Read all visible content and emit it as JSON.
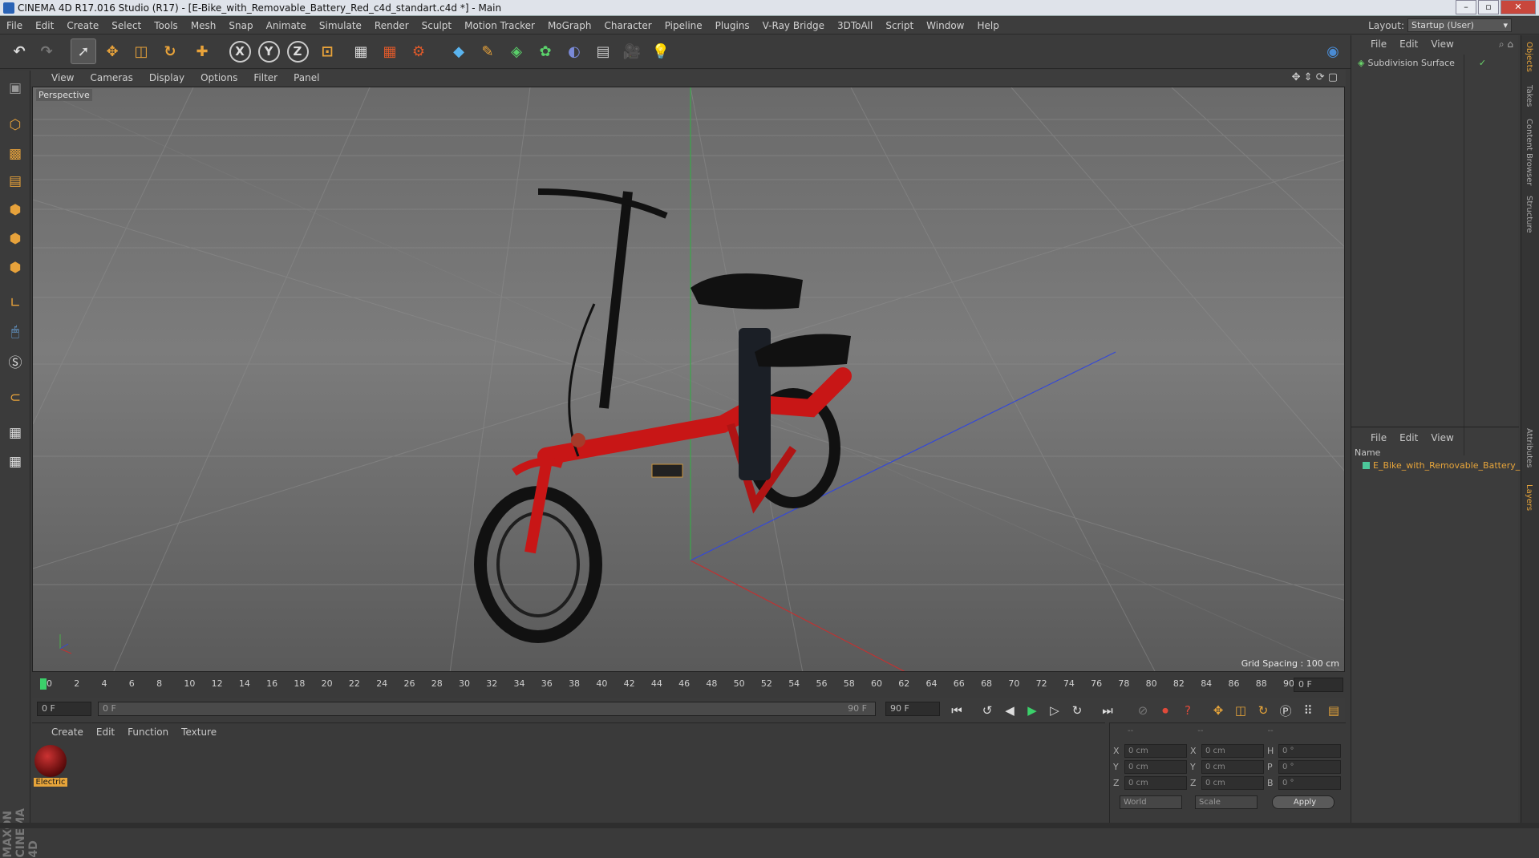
{
  "titlebar": {
    "title": "CINEMA 4D R17.016 Studio (R17) - [E-Bike_with_Removable_Battery_Red_c4d_standart.c4d *] - Main",
    "min": "–",
    "max": "▫",
    "close": "✕"
  },
  "menubar": {
    "items": [
      "File",
      "Edit",
      "Create",
      "Select",
      "Tools",
      "Mesh",
      "Snap",
      "Animate",
      "Simulate",
      "Render",
      "Sculpt",
      "Motion Tracker",
      "MoGraph",
      "Character",
      "Pipeline",
      "Plugins",
      "V-Ray Bridge",
      "3DToAll",
      "Script",
      "Window",
      "Help"
    ],
    "layout_label": "Layout:",
    "layout_value": "Startup (User)"
  },
  "toolbar": {
    "axis_x": "X",
    "axis_y": "Y",
    "axis_z": "Z"
  },
  "viewport": {
    "menu": [
      "View",
      "Cameras",
      "Display",
      "Options",
      "Filter",
      "Panel"
    ],
    "label": "Perspective",
    "grid_spacing": "Grid Spacing : 100 cm"
  },
  "objects_panel": {
    "menu": [
      "File",
      "Edit",
      "View"
    ],
    "item": "Subdivision Surface"
  },
  "layers_panel": {
    "menu": [
      "File",
      "Edit",
      "View"
    ],
    "col_header": "Name",
    "item": "E_Bike_with_Removable_Battery_R"
  },
  "side_tabs": [
    "Objects",
    "Takes",
    "Content Browser",
    "Structure",
    "Attributes",
    "Layers"
  ],
  "timeline": {
    "ticks": [
      "0",
      "2",
      "4",
      "6",
      "8",
      "10",
      "12",
      "14",
      "16",
      "18",
      "20",
      "22",
      "24",
      "26",
      "28",
      "30",
      "32",
      "34",
      "36",
      "38",
      "40",
      "42",
      "44",
      "46",
      "48",
      "50",
      "52",
      "54",
      "56",
      "58",
      "60",
      "62",
      "64",
      "66",
      "68",
      "70",
      "72",
      "74",
      "76",
      "78",
      "80",
      "82",
      "84",
      "86",
      "88",
      "90"
    ],
    "current": "0 F"
  },
  "transport": {
    "start": "0 F",
    "range_start": "0 F",
    "range_end": "90 F",
    "end": "90 F"
  },
  "material_panel": {
    "menu": [
      "Create",
      "Edit",
      "Function",
      "Texture"
    ],
    "material_name": "Electric"
  },
  "coords": {
    "header": [
      "--",
      "--",
      "--"
    ],
    "rows": [
      {
        "a": "X",
        "av": "0 cm",
        "b": "X",
        "bv": "0 cm",
        "c": "H",
        "cv": "0 °"
      },
      {
        "a": "Y",
        "av": "0 cm",
        "b": "Y",
        "bv": "0 cm",
        "c": "P",
        "cv": "0 °"
      },
      {
        "a": "Z",
        "av": "0 cm",
        "b": "Z",
        "bv": "0 cm",
        "c": "B",
        "cv": "0 °"
      }
    ],
    "mode1": "World",
    "mode2": "Scale",
    "apply": "Apply"
  },
  "branding": "MAXON CINEMA 4D"
}
